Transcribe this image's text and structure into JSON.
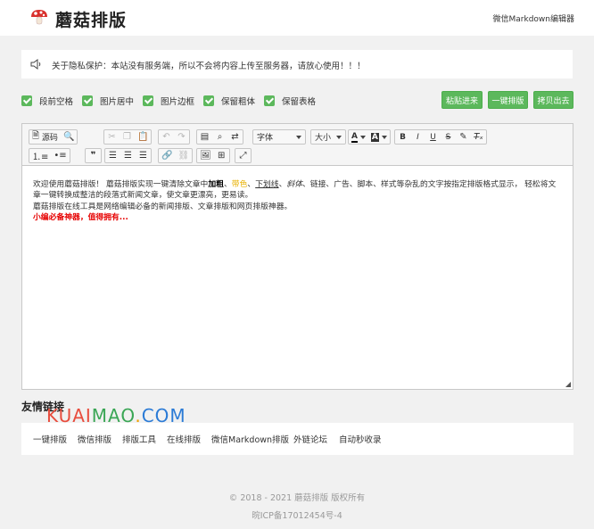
{
  "header": {
    "logo_text": "蘑菇排版",
    "nav_link": "微信Markdown编辑器"
  },
  "notice": {
    "text": "关于隐私保护：本站没有服务端，所以不会将内容上传至服务器，请放心使用！！！"
  },
  "options": [
    {
      "label": "段前空格",
      "checked": true
    },
    {
      "label": "图片居中",
      "checked": true
    },
    {
      "label": "图片边框",
      "checked": true
    },
    {
      "label": "保留粗体",
      "checked": true
    },
    {
      "label": "保留表格",
      "checked": true
    }
  ],
  "buttons": {
    "paste": "粘贴进来",
    "format": "一键排版",
    "copy": "拷贝出去"
  },
  "toolbar": {
    "source": "源码",
    "font": "字体",
    "size": "大小",
    "bold": "B",
    "italic": "I",
    "underline": "U",
    "strike": "S",
    "text_color": "A",
    "bg_color": "A"
  },
  "content": {
    "p1_a": "欢迎使用蘑菇排版！ 蘑菇排版实现一键清除文章中",
    "p1_bold": "加粗",
    "p1_sep1": "、",
    "p1_color": "带色",
    "p1_sep2": "、",
    "p1_under": "下划线",
    "p1_sep3": "、",
    "p1_italic": "斜体",
    "p1_rest": "、链接、广告、脚本、样式等杂乱的文字按指定排版格式显示， 轻松将文章一键转换成整洁的段落式新闻文章，使文章更漂亮，更易读。",
    "p2": "蘑菇排版在线工具是网络编辑必备的新闻排版、文章排版和网页排版神器。",
    "p3": "小编必备神器，值得拥有..."
  },
  "friends": {
    "title": "友情链接",
    "watermark": [
      "KUAI",
      "MAO",
      ".",
      "COM"
    ],
    "links": [
      "一键排版",
      "微信排版",
      "排版工具",
      "在线排版",
      "微信Markdown排版",
      "外链论坛",
      "自动秒收录"
    ]
  },
  "footer": {
    "copyright": "© 2018 - 2021 蘑菇排版 版权所有",
    "icp": "晥ICP备17012454号-4"
  }
}
